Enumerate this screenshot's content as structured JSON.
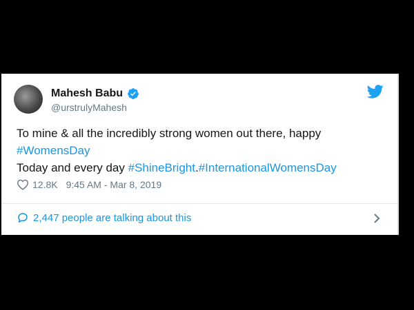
{
  "tweet": {
    "author_name": "Mahesh Babu",
    "handle": "@urstrulyMahesh",
    "text_part1": "To mine & all the incredibly strong women out there, happy ",
    "hashtag_womensday": "#WomensDay",
    "text_part2": "Today and every day ",
    "hashtag_shinebright": "#ShineBright",
    "separator_dot": ".",
    "hashtag_intlwomensday": "#InternationalWomensDay",
    "like_count": "12.8K",
    "timestamp": "9:45 AM - Mar 8, 2019",
    "conversation_text": "2,447 people are talking about this"
  },
  "icons": {
    "verified": "verified-badge-icon",
    "bird": "twitter-bird-icon",
    "heart": "heart-icon",
    "bubble": "reply-bubble-icon",
    "chevron": "chevron-right-icon"
  },
  "colors": {
    "background": "#000000",
    "card": "#ffffff",
    "link": "#1b95e0",
    "text": "#14171a",
    "muted": "#657786"
  }
}
